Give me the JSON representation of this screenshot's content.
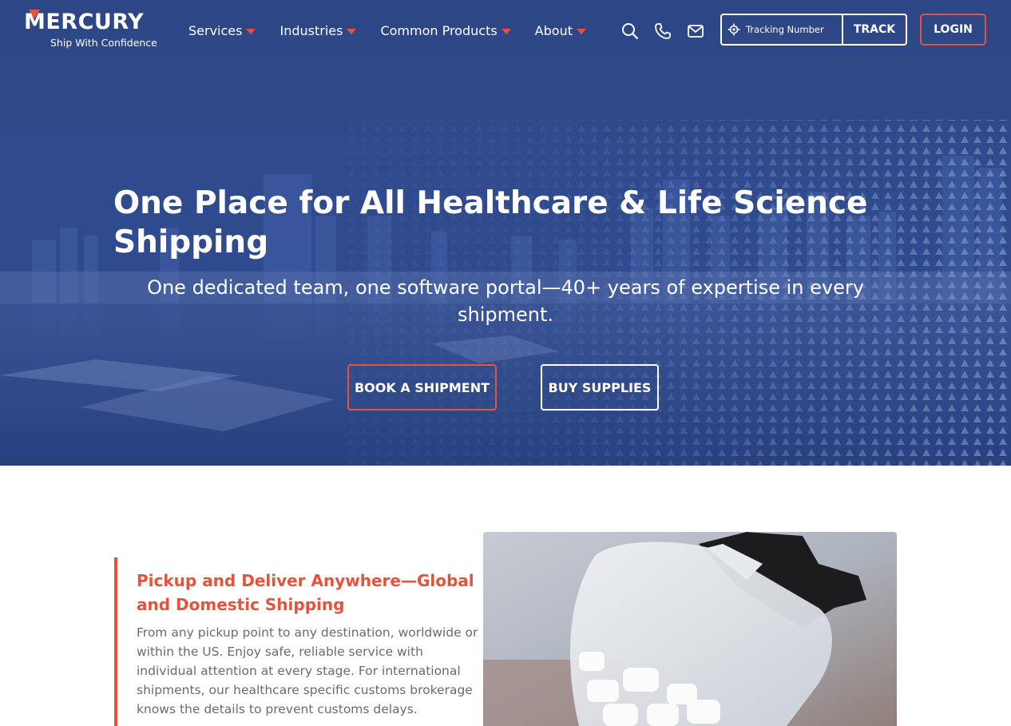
{
  "brand": {
    "name": "MERCURY",
    "tagline": "Ship With Confidence",
    "accent_color": "#e5533d",
    "hero_color": "#2f4a8f"
  },
  "nav": {
    "items": [
      {
        "label": "Services"
      },
      {
        "label": "Industries"
      },
      {
        "label": "Common Products"
      },
      {
        "label": "About"
      }
    ]
  },
  "header": {
    "icons": [
      "search-icon",
      "phone-icon",
      "mail-icon"
    ],
    "tracking": {
      "placeholder": "Tracking Number",
      "button_label": "TRACK"
    },
    "login_label": "LOGIN"
  },
  "hero": {
    "title": "One Place for All Healthcare & Life Science Shipping",
    "subtitle": "One dedicated team, one software portal—40+ years of expertise in every shipment.",
    "book_label": "BOOK A SHIPMENT",
    "buy_label": "BUY SUPPLIES"
  },
  "feature": {
    "title": "Pickup and Deliver Anywhere—Global and Domestic Shipping",
    "body": "From any pickup point to any destination, worldwide or within the US. Enjoy safe, reliable service with individual attention at every stage. For international shipments, our healthcare specific customs brokerage knows the details to prevent customs delays."
  }
}
